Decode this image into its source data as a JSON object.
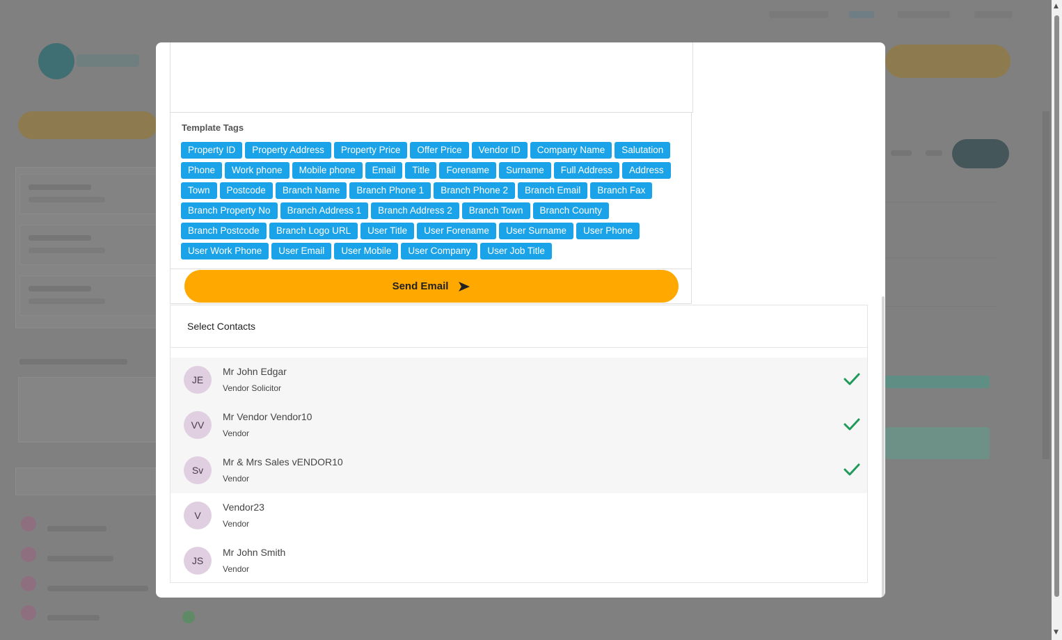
{
  "template_tags": {
    "title": "Template Tags",
    "tags": [
      "Property ID",
      "Property Address",
      "Property Price",
      "Offer Price",
      "Vendor ID",
      "Company Name",
      "Salutation",
      "Phone",
      "Work phone",
      "Mobile phone",
      "Email",
      "Title",
      "Forename",
      "Surname",
      "Full Address",
      "Address",
      "Town",
      "Postcode",
      "Branch Name",
      "Branch Phone 1",
      "Branch Phone 2",
      "Branch Email",
      "Branch Fax",
      "Branch Property No",
      "Branch Address 1",
      "Branch Address 2",
      "Branch Town",
      "Branch County",
      "Branch Postcode",
      "Branch Logo URL",
      "User Title",
      "User Forename",
      "User Surname",
      "User Phone",
      "User Work Phone",
      "User Email",
      "User Mobile",
      "User Company",
      "User Job Title"
    ]
  },
  "send_button": {
    "label": "Send Email",
    "icon": "send-arrow-icon",
    "color": "#ffa800"
  },
  "contacts": {
    "title": "Select Contacts",
    "items": [
      {
        "initials": "JE",
        "name": "Mr John Edgar",
        "role": "Vendor Solicitor",
        "selected": true
      },
      {
        "initials": "VV",
        "name": "Mr Vendor Vendor10",
        "role": "Vendor",
        "selected": true
      },
      {
        "initials": "Sv",
        "name": "Mr & Mrs Sales vENDOR10",
        "role": "Vendor",
        "selected": true
      },
      {
        "initials": "V",
        "name": "Vendor23",
        "role": "Vendor",
        "selected": false
      },
      {
        "initials": "JS",
        "name": "Mr John Smith",
        "role": "Vendor",
        "selected": false
      }
    ],
    "check_color": "#1f9a5a"
  },
  "colors": {
    "tag": "#1aa3e8",
    "avatar": "#e0cfe1",
    "overlay": "#808080"
  }
}
